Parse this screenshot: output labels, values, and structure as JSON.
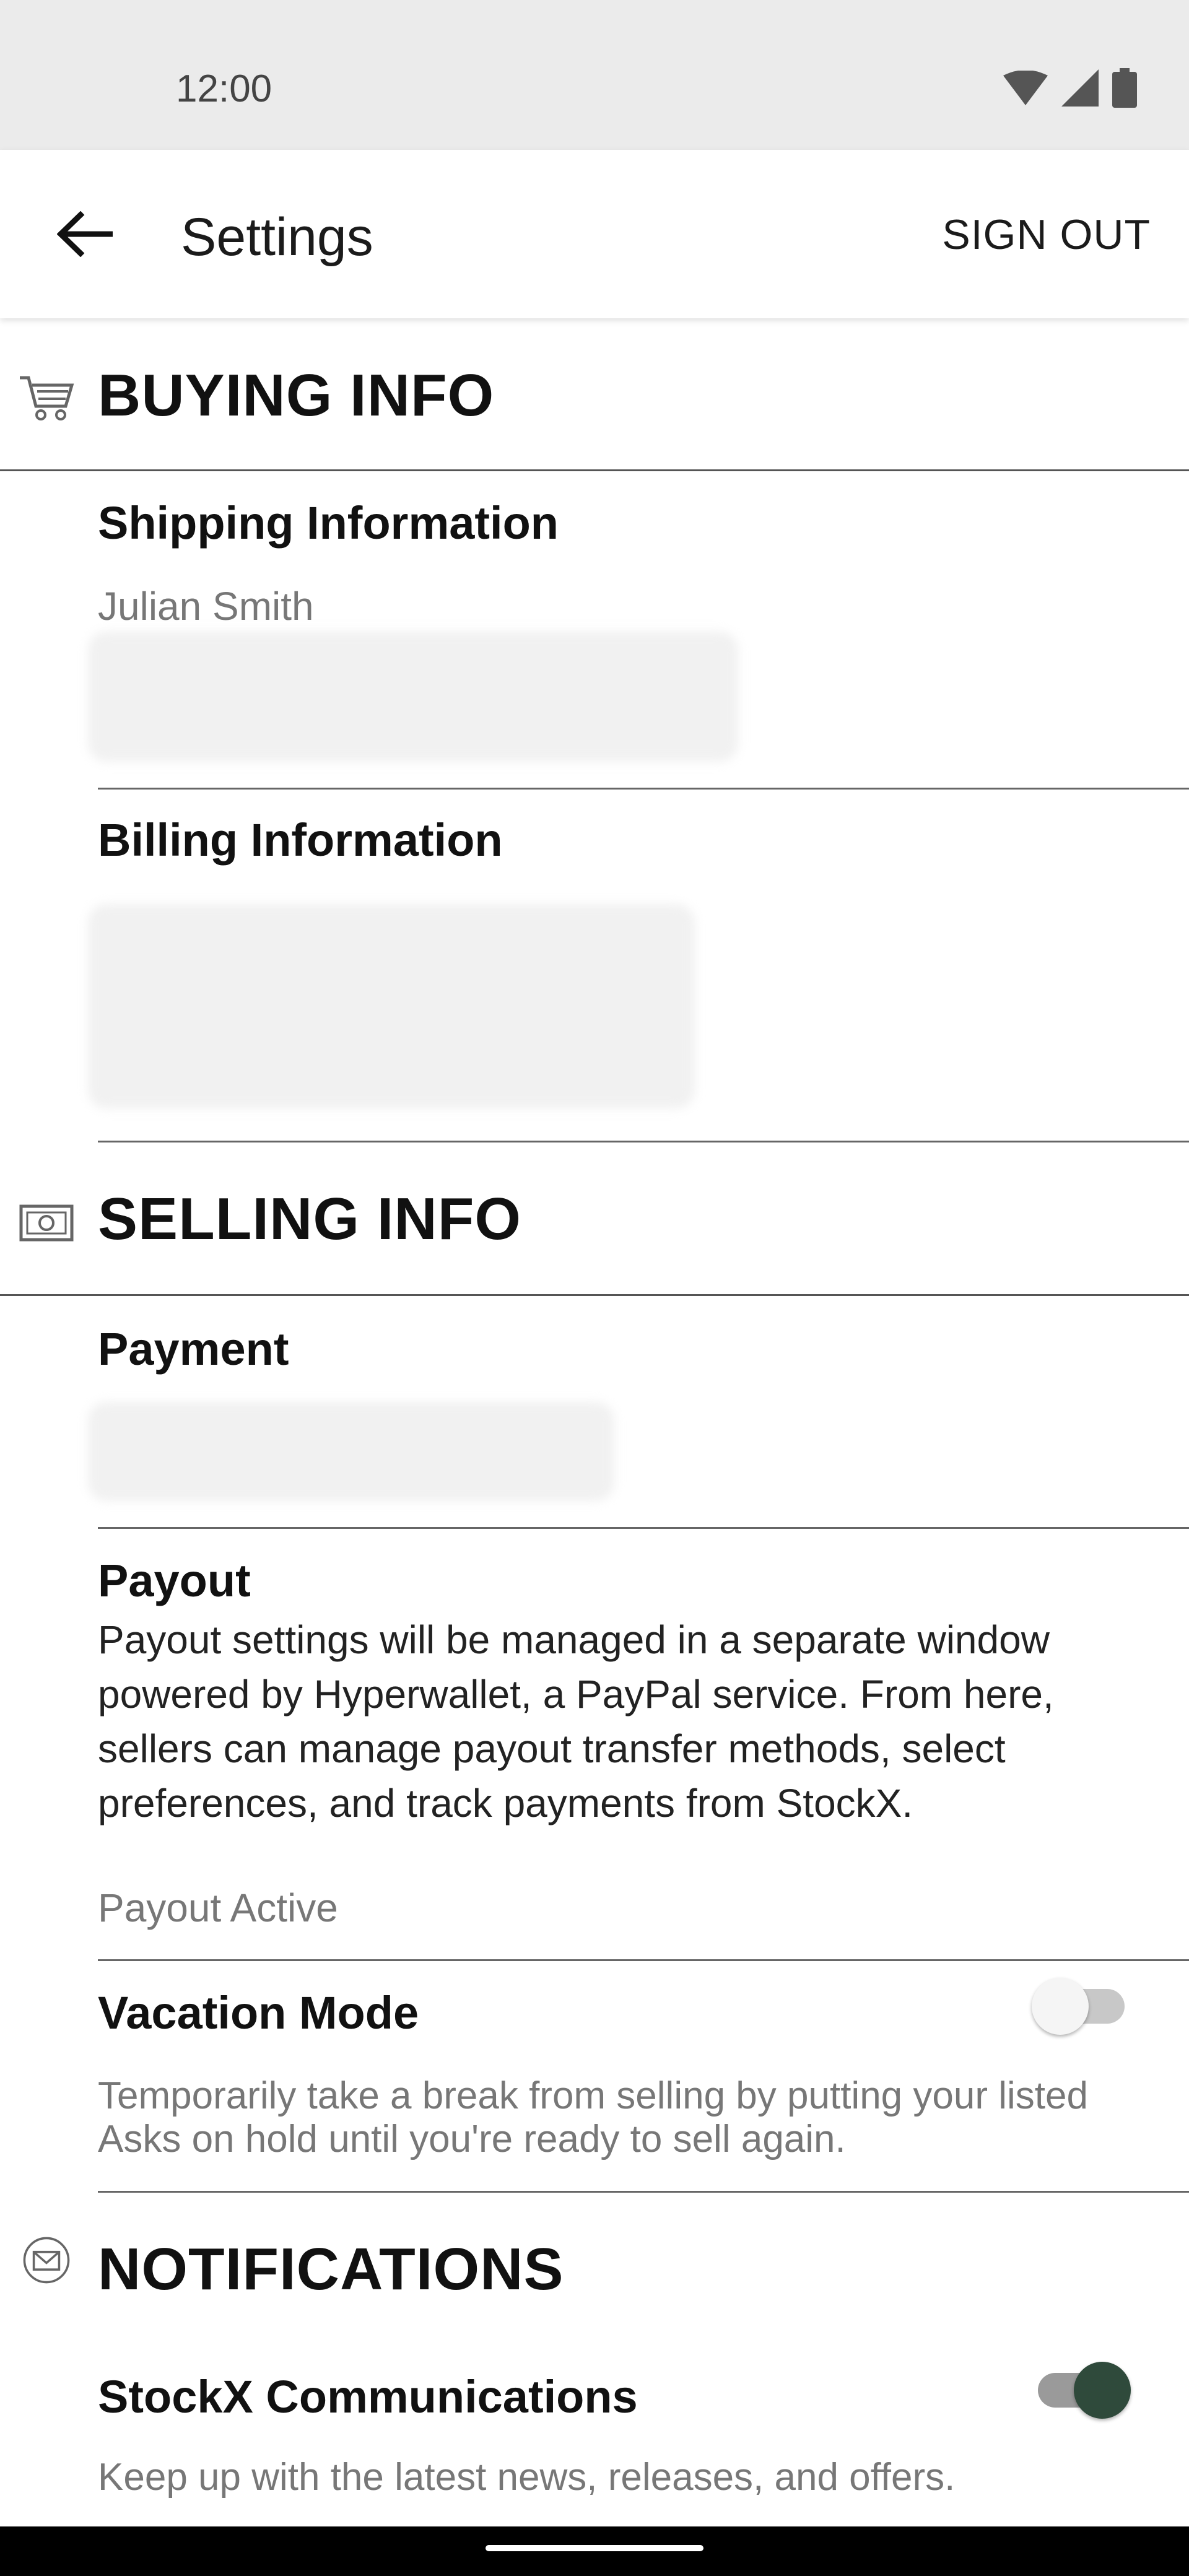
{
  "status_bar": {
    "time": "12:00"
  },
  "app_bar": {
    "title": "Settings",
    "sign_out_label": "SIGN OUT"
  },
  "buying_info": {
    "title": "BUYING INFO",
    "shipping": {
      "title": "Shipping Information",
      "name": "Julian Smith"
    },
    "billing": {
      "title": "Billing Information"
    }
  },
  "selling_info": {
    "title": "SELLING INFO",
    "payment": {
      "title": "Payment"
    },
    "payout": {
      "title": "Payout",
      "body": "Payout settings will be managed in a separate window powered by Hyperwallet, a PayPal service. From here, sellers can manage payout transfer methods, select preferences, and track payments from StockX.",
      "status": "Payout Active"
    },
    "vacation": {
      "title": "Vacation Mode",
      "description": "Temporarily take a break from selling by putting your listed Asks on hold until you're ready to sell again.",
      "enabled": false
    }
  },
  "notifications": {
    "title": "NOTIFICATIONS",
    "communications": {
      "title": "StockX Communications",
      "description": "Keep up with the latest news, releases, and offers.",
      "enabled": true
    }
  },
  "icons": {
    "back": "arrow-left-icon",
    "buying": "shopping-cart-icon",
    "selling": "cash-icon",
    "notifications": "envelope-icon"
  },
  "colors": {
    "toggle_on": "#2f4a3b",
    "divider": "#555555"
  }
}
